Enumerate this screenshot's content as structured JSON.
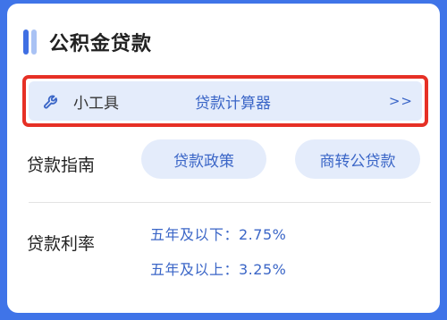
{
  "card": {
    "title": "公积金贷款"
  },
  "tools": {
    "label": "小工具",
    "calculator_label": "贷款计算器",
    "more_label": ">>",
    "icon": "wrench-icon"
  },
  "guide": {
    "label": "贷款指南",
    "buttons": [
      {
        "label": "贷款政策"
      },
      {
        "label": "商转公贷款"
      }
    ]
  },
  "rates": {
    "label": "贷款利率",
    "items": [
      {
        "text": "五年及以下：2.75%"
      },
      {
        "text": "五年及以上：3.25%"
      }
    ]
  },
  "colors": {
    "background": "#3f74e8",
    "accent": "#3f6fe3",
    "link": "#3b66c7",
    "pill_bg": "#e4ecfb",
    "highlight": "#e63025"
  }
}
